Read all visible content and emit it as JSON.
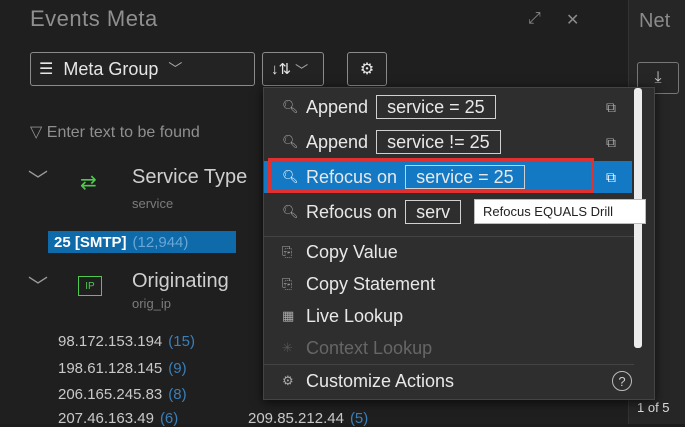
{
  "panel": {
    "title": "Events Meta",
    "meta_group_label": "Meta Group",
    "filter_placeholder": "Enter text to be found"
  },
  "groups": [
    {
      "title": "Service Type",
      "sub": "service"
    },
    {
      "title": "Originating",
      "sub": "orig_ip"
    }
  ],
  "selected_tag": {
    "label": "25 [SMTP]",
    "count": "(12,944)"
  },
  "values": [
    {
      "ip": "98.172.153.194",
      "count": "(15)"
    },
    {
      "ip": "198.61.128.145",
      "count": "(9)"
    },
    {
      "ip": "206.165.245.83",
      "count": "(8)"
    },
    {
      "ip": "207.46.163.49",
      "count": "(6)"
    },
    {
      "ip": "209.85.212.44",
      "count": "(5)"
    }
  ],
  "right_panel": {
    "title": "Net",
    "pager": "1 of 5"
  },
  "menu": {
    "items": [
      {
        "label": "Append",
        "pill": "service = 25"
      },
      {
        "label": "Append",
        "pill": "service != 25"
      },
      {
        "label": "Refocus on",
        "pill": "service = 25"
      },
      {
        "label": "Refocus on",
        "pill": "serv"
      },
      {
        "label": "Copy Value"
      },
      {
        "label": "Copy Statement"
      },
      {
        "label": "Live Lookup"
      },
      {
        "label": "Context Lookup"
      },
      {
        "label": "Customize Actions"
      }
    ],
    "help": "?"
  },
  "tooltip": "Refocus EQUALS Drill"
}
